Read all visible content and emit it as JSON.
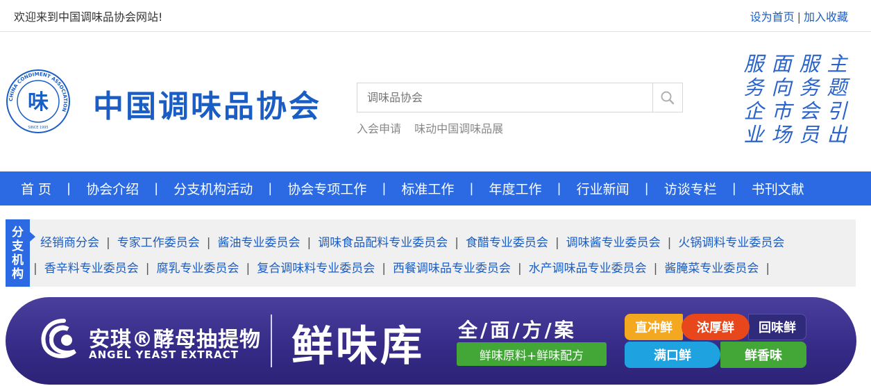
{
  "topbar": {
    "welcome": "欢迎来到中国调味品协会网站!",
    "set_home": "设为首页",
    "separator": "|",
    "add_favorite": "加入收藏"
  },
  "header": {
    "logo_seal_char": "味",
    "logo_seal_ring_text": "CHINA CONDIMENT ASSOCIATION",
    "logo_seal_since": "SINCE 1995",
    "logo_name": "中国调味品协会",
    "search_placeholder": "调味品协会",
    "hot_links": [
      "入会申请",
      "味动中国调味品展"
    ],
    "calligraphy_columns": [
      "主题引出",
      "服务会员",
      "面向市场",
      "服务企业"
    ]
  },
  "nav": {
    "items": [
      "首  页",
      "协会介绍",
      "分支机构活动",
      "协会专项工作",
      "标准工作",
      "年度工作",
      "行业新闻",
      "访谈专栏",
      "书刊文献"
    ],
    "divider": "|"
  },
  "branch": {
    "tag": [
      "分",
      "支",
      "机",
      "构"
    ],
    "row1": [
      "经销商分会",
      "专家工作委员会",
      "酱油专业委员会",
      "调味食品配料专业委员会",
      "食醋专业委员会",
      "调味酱专业委员会",
      "火锅调料专业委员会"
    ],
    "row2": [
      "香辛料专业委员会",
      "腐乳专业委员会",
      "复合调味料专业委员会",
      "西餐调味品专业委员会",
      "水产调味品专业委员会",
      "酱腌菜专业委员会"
    ]
  },
  "banner": {
    "brand_cn": "安琪®酵母抽提物",
    "brand_en": "ANGEL YEAST EXTRACT",
    "product": "鲜味库",
    "slogan": "全/面/方/案",
    "green_bar": "鲜味原料+鲜味配方",
    "badges": [
      "直冲鲜",
      "浓厚鲜",
      "回味鲜",
      "满口鲜",
      "鲜香味"
    ]
  },
  "colors": {
    "primary_blue": "#2b6ae2",
    "link_blue": "#1a5dc4",
    "banner_purple": "#352a86"
  }
}
